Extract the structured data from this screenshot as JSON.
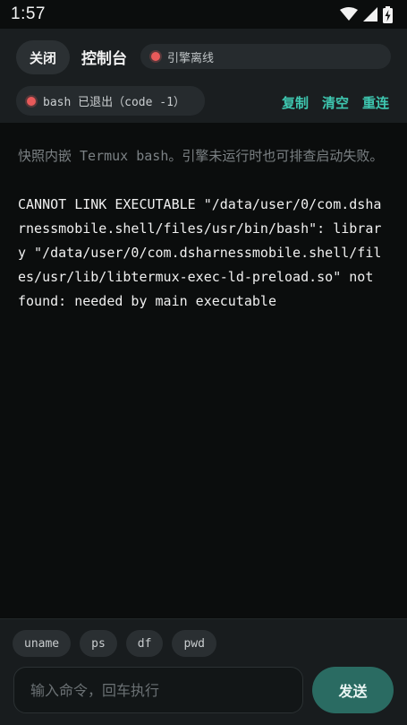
{
  "status_bar": {
    "time": "1:57",
    "icons": [
      "wifi-icon",
      "signal-icon",
      "battery-charging-icon"
    ]
  },
  "header": {
    "close_label": "关闭",
    "title": "控制台",
    "engine_status": "引擎离线",
    "engine_status_color": "#e85a5a",
    "session_status": "bash 已退出（code -1）",
    "session_status_color": "#e85a5a",
    "actions": {
      "copy": "复制",
      "clear": "清空",
      "reconnect": "重连"
    },
    "accent_color": "#3ec7b0"
  },
  "terminal": {
    "hint": "快照内嵌 Termux bash。引擎未运行时也可排查启动失败。",
    "output": "CANNOT LINK EXECUTABLE \"/data/user/0/com.dsharnessmobile.shell/files/usr/bin/bash\": library \"/data/user/0/com.dsharnessmobile.shell/files/usr/lib/libtermux-exec-ld-preload.so\" not found: needed by main executable"
  },
  "quick_commands": [
    "uname",
    "ps",
    "df",
    "pwd"
  ],
  "input": {
    "placeholder": "输入命令，回车执行",
    "value": "",
    "send_label": "发送"
  }
}
